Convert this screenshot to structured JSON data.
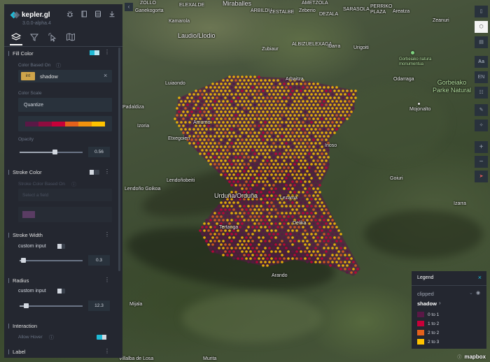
{
  "app": {
    "name": "kepler.gl",
    "version": "3.0.0-alpha.4"
  },
  "header_icons": [
    "bug-icon",
    "book-icon",
    "database-icon",
    "download-icon"
  ],
  "tabs": [
    {
      "name": "layers",
      "active": true
    },
    {
      "name": "filters",
      "active": false
    },
    {
      "name": "interactions",
      "active": false
    },
    {
      "name": "basemap",
      "active": false
    }
  ],
  "layer_config": {
    "fill_color": {
      "title": "Fill Color",
      "color_based_on_label": "Color Based On",
      "field_type": "int",
      "field_name": "shadow",
      "color_scale_label": "Color Scale",
      "color_scale": "Quantize",
      "palette": [
        "#5A1846",
        "#900C3F",
        "#C70039",
        "#E3611C",
        "#F1920E",
        "#FFC300"
      ],
      "opacity_label": "Opacity",
      "opacity": "0.56",
      "opacity_fraction": 0.56
    },
    "stroke_color": {
      "title": "Stroke Color",
      "color_based_on_label": "Stroke Color Based On",
      "select_placeholder": "Select a field",
      "swatch": "#5a3c63"
    },
    "stroke_width": {
      "title": "Stroke Width",
      "custom_input_label": "custom input",
      "value": "0.3",
      "fraction": 0.05
    },
    "radius": {
      "title": "Radius",
      "custom_input_label": "custom input",
      "value": "12.3",
      "fraction": 0.1
    },
    "interaction": {
      "title": "Interaction",
      "allow_hover_label": "Allow Hover",
      "allow_hover": true
    },
    "label": {
      "title": "Label"
    }
  },
  "legend": {
    "title": "Legend",
    "layer_name": "clipped",
    "attribute": "shadow",
    "items": [
      {
        "label": "0 to 1",
        "color": "#5a1846"
      },
      {
        "label": "1 to 2",
        "color": "#c70039"
      },
      {
        "label": "2 to 2",
        "color": "#e3611c"
      },
      {
        "label": "2 to 3",
        "color": "#ffc300"
      }
    ]
  },
  "map_labels": {
    "zollo": "ZOLLO",
    "ganekogorta": "Ganekogorta",
    "elexalde": "ELEXALDE",
    "miraballes": "Miraballes",
    "arbildu": "ARBILDU",
    "zestalbe": "ZESTALBE",
    "zeberio": "Zeberio",
    "dezala": "DEZALA",
    "amets": "AMETZOLA",
    "sarasola": "SARASOLA",
    "perriko": "PERRIKO PLAZA",
    "areatza": "Areatza",
    "zeanuri": "Zeanuri",
    "kamarola": "Kamarola",
    "laudio": "Laudio/Llodio",
    "zubiaur": "Zubiaur",
    "albizu": "ALBIZUELEXAGA",
    "ibarra": "Ibarra",
    "urigoiti": "Urigoiti",
    "monument": "Gorbeiako natura\nmonumentua",
    "odarraga": "Odarraga",
    "gorbeia_park": "Gorbeiako\nParke Natural",
    "luiaondo": "Luiaondo",
    "arbaitza": "Arbaitza",
    "padaldiza": "Padaldiza",
    "izoria": "Izoria",
    "amurrio": "Amurrio",
    "etxegoien": "Etxegoien",
    "inoso": "Inoso",
    "mojonalto": "Mojonalto",
    "lendoñobeiti": "Lendoñobeiti",
    "lendoño_goikoa": "Lendoño Goikoa",
    "orduña": "Urduña/Orduña",
    "tertanga": "Tertanga",
    "lezama": "Lezama",
    "goiuri": "Goiuri",
    "izarra": "Izarra",
    "delika": "Delika",
    "arando": "Arando",
    "mijala": "Mijala",
    "villalba": "Villalba de Losa",
    "murita": "Murita",
    "mapbox": "mapbox"
  }
}
